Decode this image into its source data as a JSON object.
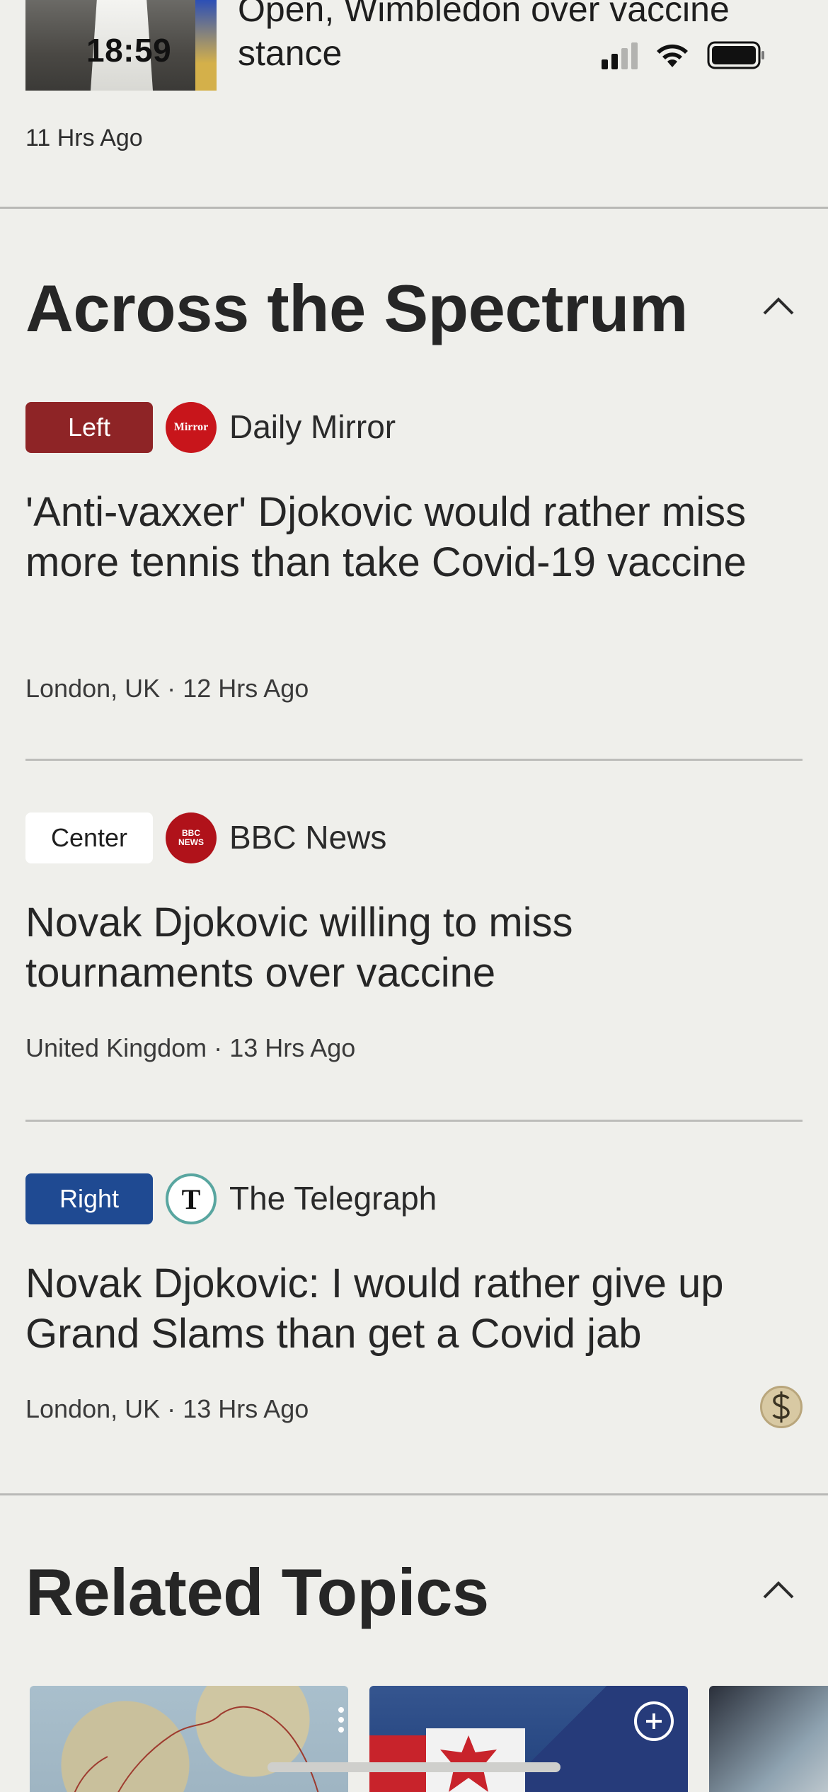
{
  "status_bar": {
    "time": "18:59"
  },
  "top_story": {
    "title": "Open, Wimbledon over vaccine stance",
    "time": "11 Hrs Ago"
  },
  "across_spectrum": {
    "title": "Across the Spectrum",
    "articles": [
      {
        "bias": "Left",
        "bias_color": "#8e2426",
        "source": "Daily Mirror",
        "logo_text": "Mirror",
        "headline": "'Anti-vaxxer' Djokovic would rather miss more tennis than take Covid-19 vaccine",
        "location": "London, UK",
        "time": "12 Hrs Ago"
      },
      {
        "bias": "Center",
        "bias_color": "#ffffff",
        "source": "BBC News",
        "logo_text": "BBC NEWS",
        "headline": "Novak Djokovic willing to miss tournaments over vaccine",
        "location": "United Kingdom",
        "time": "13 Hrs Ago"
      },
      {
        "bias": "Right",
        "bias_color": "#1f4a92",
        "source": "The Telegraph",
        "logo_text": "T",
        "headline": "Novak Djokovic: I would rather give up Grand Slams than get a Covid jab",
        "location": "London, UK",
        "time": "13 Hrs Ago"
      }
    ],
    "separator": "·"
  },
  "related_topics": {
    "title": "Related Topics"
  },
  "icons": {
    "section_toggle": "chevron-up-icon",
    "paywall": "dollar-coin-icon",
    "card_menu": "more-vertical-icon",
    "card_add": "plus-circle-icon"
  }
}
